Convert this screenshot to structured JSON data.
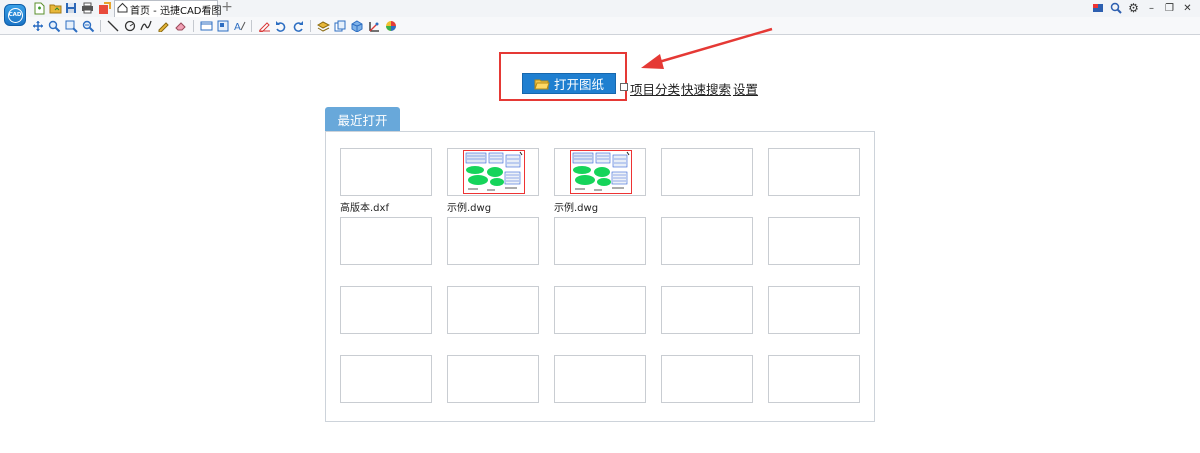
{
  "app": {
    "logo_text": "CAD",
    "tab_title": "首页 - 迅捷CAD看图",
    "tab_add": "+",
    "window_controls": [
      "flag-icon",
      "search-icon",
      "gear-icon",
      "minimize-icon",
      "restore-icon",
      "close-icon"
    ],
    "window_control_glyphs": {
      "minimize": "–",
      "restore": "❐",
      "close": "✕"
    }
  },
  "toolbar": {
    "quick_access": [
      "new-file-icon",
      "open-file-icon",
      "save-icon",
      "print-icon",
      "export-icon"
    ],
    "tools": [
      "pan-icon",
      "zoom-in-icon",
      "zoom-window-icon",
      "zoom-out-icon",
      "line-icon",
      "circle-icon",
      "polyline-icon",
      "pencil-icon",
      "eraser-icon",
      "rectangle-icon",
      "layout-icon",
      "text-style-icon",
      "markup-pen-icon",
      "undo-icon",
      "redo-icon",
      "layer-icon",
      "layer-copy-icon",
      "3d-view-icon",
      "coordinate-icon",
      "color-wheel-icon"
    ]
  },
  "main": {
    "open_button": "打开图纸",
    "project_category": "项目分类",
    "quick_search": "快速搜索",
    "settings": "设置",
    "recent_tab": "最近打开"
  },
  "recent_files": [
    {
      "name": "高版本.dxf",
      "thumbnail": "blank"
    },
    {
      "name": "示例.dwg",
      "thumbnail": "drawing"
    },
    {
      "name": "示例.dwg",
      "thumbnail": "drawing"
    },
    {
      "name": "",
      "thumbnail": "blank"
    },
    {
      "name": "",
      "thumbnail": "blank"
    },
    {
      "name": "",
      "thumbnail": "blank"
    },
    {
      "name": "",
      "thumbnail": "blank"
    },
    {
      "name": "",
      "thumbnail": "blank"
    },
    {
      "name": "",
      "thumbnail": "blank"
    },
    {
      "name": "",
      "thumbnail": "blank"
    },
    {
      "name": "",
      "thumbnail": "blank"
    },
    {
      "name": "",
      "thumbnail": "blank"
    },
    {
      "name": "",
      "thumbnail": "blank"
    },
    {
      "name": "",
      "thumbnail": "blank"
    },
    {
      "name": "",
      "thumbnail": "blank"
    },
    {
      "name": "",
      "thumbnail": "blank"
    },
    {
      "name": "",
      "thumbnail": "blank"
    },
    {
      "name": "",
      "thumbnail": "blank"
    },
    {
      "name": "",
      "thumbnail": "blank"
    },
    {
      "name": "",
      "thumbnail": "blank"
    }
  ],
  "colors": {
    "accent": "#1f7fd0",
    "recent_tab": "#68a8da",
    "highlight": "#e53935",
    "drawing_green": "#16d45a",
    "drawing_blue": "#3565d8"
  }
}
